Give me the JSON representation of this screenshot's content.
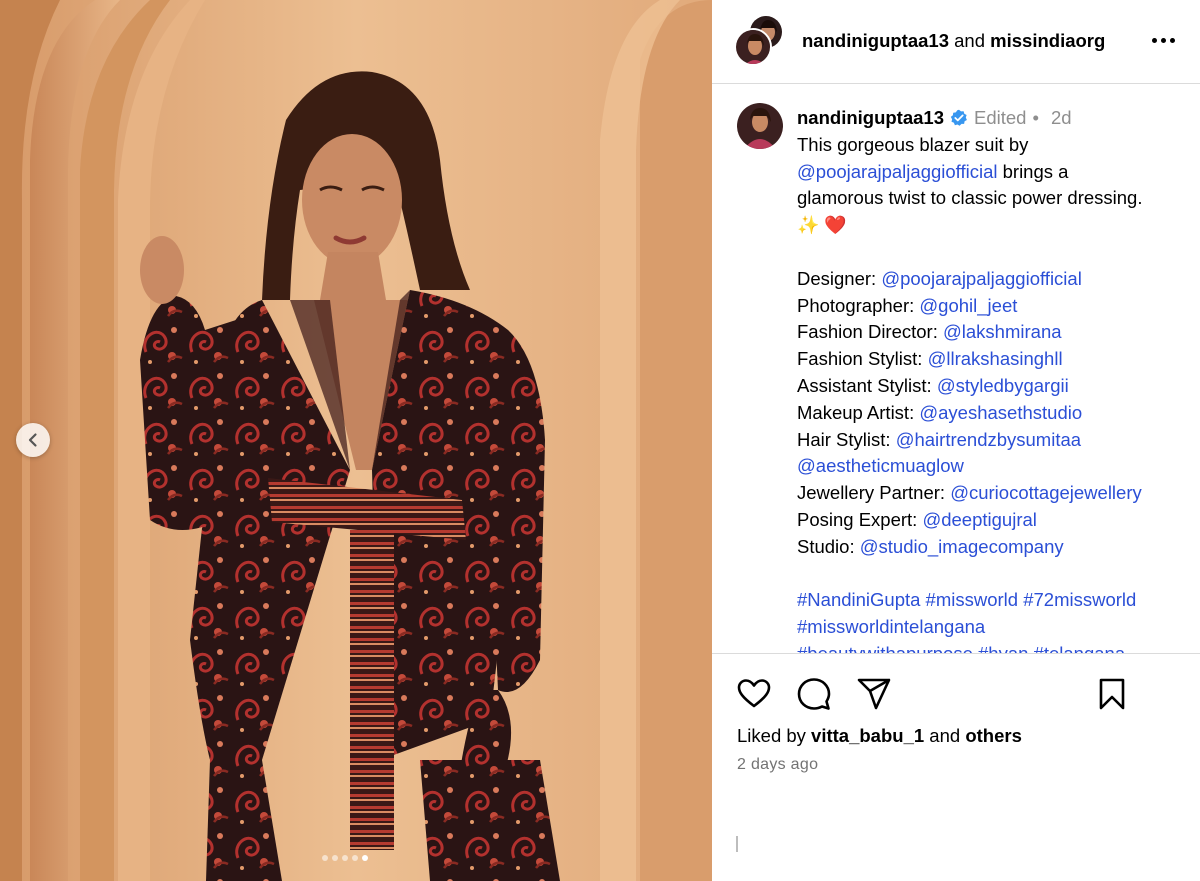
{
  "header": {
    "user1": "nandiniguptaa13",
    "connector": "and",
    "user2": "missindiaorg",
    "more_icon": "more-horizontal-icon"
  },
  "caption": {
    "username": "nandiniguptaa13",
    "edited": "Edited",
    "separator": "•",
    "time_short": "2d",
    "line1": "This gorgeous blazer suit by",
    "mention_brand": "@poojarajpaljaggiofficial",
    "line2_rest": " brings a",
    "line3": "glamorous twist to classic power dressing.",
    "emojis": "✨ ❤️",
    "credits": [
      {
        "label": "Designer: ",
        "handle": "@poojarajpaljaggiofficial"
      },
      {
        "label": "Photographer: ",
        "handle": "@gohil_jeet"
      },
      {
        "label": "Fashion Director: ",
        "handle": "@lakshmirana"
      },
      {
        "label": "Fashion Stylist: ",
        "handle": "@llrakshasinghll"
      },
      {
        "label": "Assistant Stylist: ",
        "handle": "@styledbygargii"
      },
      {
        "label": "Makeup Artist: ",
        "handle": "@ayeshasethstudio"
      },
      {
        "label": "Hair Stylist: ",
        "handle": "@hairtrendzbysumitaa"
      },
      {
        "label": "",
        "handle": "@aestheticmuaglow"
      },
      {
        "label": "Jewellery Partner: ",
        "handle": "@curiocottagejewellery"
      },
      {
        "label": "Posing Expert: ",
        "handle": "@deeptigujral"
      },
      {
        "label": "Studio: ",
        "handle": "@studio_imagecompany"
      }
    ],
    "hashtags_line1": "#NandiniGupta #missworld #72missworld",
    "hashtags_line2": "#missworldintelangana",
    "hashtags_line3": "#beautywithapurpose #hyan #telangana"
  },
  "actions": {
    "liked_prefix": "Liked by ",
    "liked_user": "vitta_babu_1",
    "liked_connector": " and ",
    "liked_others": "others",
    "time_ago": "2 days ago"
  },
  "carousel": {
    "total_slides": 5,
    "active_slide": 5
  },
  "colors": {
    "link": "#2b4fd6",
    "verified": "#3897f0",
    "muted": "#8e8e8e",
    "divider": "#dbdbdb"
  }
}
